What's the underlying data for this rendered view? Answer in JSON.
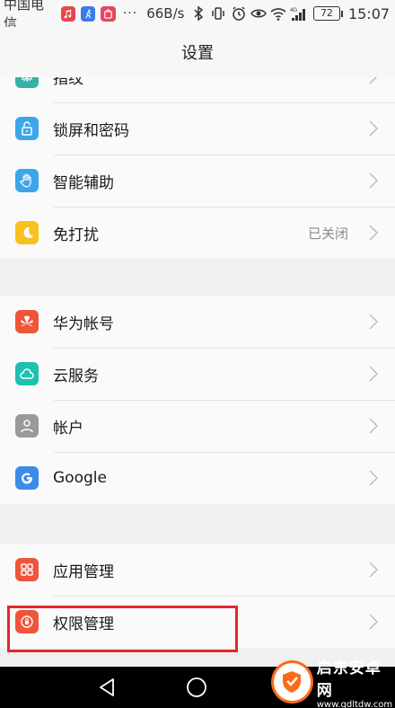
{
  "status_bar": {
    "carrier": "中国电信",
    "dots": "···",
    "net_speed": "66B/s",
    "battery": "72",
    "time": "15:07"
  },
  "header": {
    "title": "设置"
  },
  "groups": [
    {
      "items": [
        {
          "label": "指纹",
          "icon": "fingerprint-icon",
          "color": "#34b2a8"
        },
        {
          "label": "锁屏和密码",
          "icon": "lock-icon",
          "color": "#3da5ea"
        },
        {
          "label": "智能辅助",
          "icon": "hand-icon",
          "color": "#3da5ea"
        },
        {
          "label": "免打扰",
          "icon": "moon-icon",
          "color": "#f7c11f",
          "value": "已关闭"
        }
      ]
    },
    {
      "items": [
        {
          "label": "华为帐号",
          "icon": "huawei-icon",
          "color": "#f0543a"
        },
        {
          "label": "云服务",
          "icon": "cloud-icon",
          "color": "#1ec0b0"
        },
        {
          "label": "帐户",
          "icon": "person-icon",
          "color": "#9a9a9a"
        },
        {
          "label": "Google",
          "icon": "google-icon",
          "color": "#3b8bea"
        }
      ]
    },
    {
      "items": [
        {
          "label": "应用管理",
          "icon": "apps-grid-icon",
          "color": "#f0543a"
        },
        {
          "label": "权限管理",
          "icon": "permission-icon",
          "color": "#f0543a"
        }
      ]
    }
  ],
  "watermark": {
    "title": "启东安卓网",
    "url": "www.qdltdw.com"
  },
  "colors": {
    "highlight": "#e8262b",
    "section_bg": "#f0f0f0",
    "row_bg": "#fafafa"
  }
}
